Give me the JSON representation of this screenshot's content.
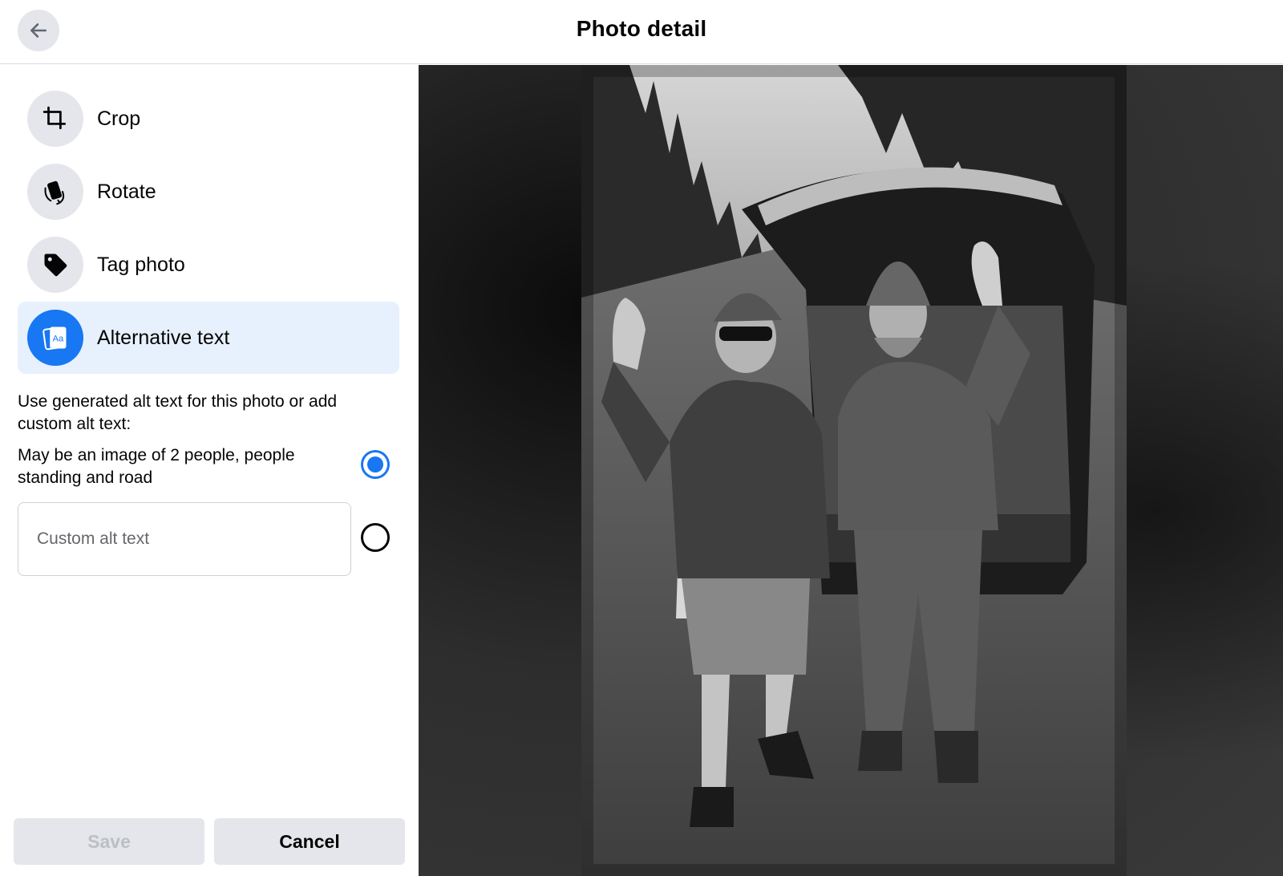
{
  "header": {
    "title": "Photo detail",
    "back_icon": "arrow-left-icon"
  },
  "menu": {
    "items": [
      {
        "label": "Crop",
        "icon": "crop-icon",
        "active": false
      },
      {
        "label": "Rotate",
        "icon": "rotate-icon",
        "active": false
      },
      {
        "label": "Tag photo",
        "icon": "tag-icon",
        "active": false
      },
      {
        "label": "Alternative text",
        "icon": "alt-text-icon",
        "active": true
      }
    ]
  },
  "alt_text": {
    "heading": "Use generated alt text for this photo or add custom alt text:",
    "generated": "May be an image of 2 people, people standing and road",
    "generated_selected": true,
    "custom_placeholder": "Custom alt text",
    "custom_value": "",
    "custom_selected": false
  },
  "buttons": {
    "save_label": "Save",
    "cancel_label": "Cancel",
    "save_disabled": true
  },
  "colors": {
    "accent": "#1877f2",
    "active_bg": "#e7f0fd",
    "icon_bg": "#e4e6eb"
  }
}
